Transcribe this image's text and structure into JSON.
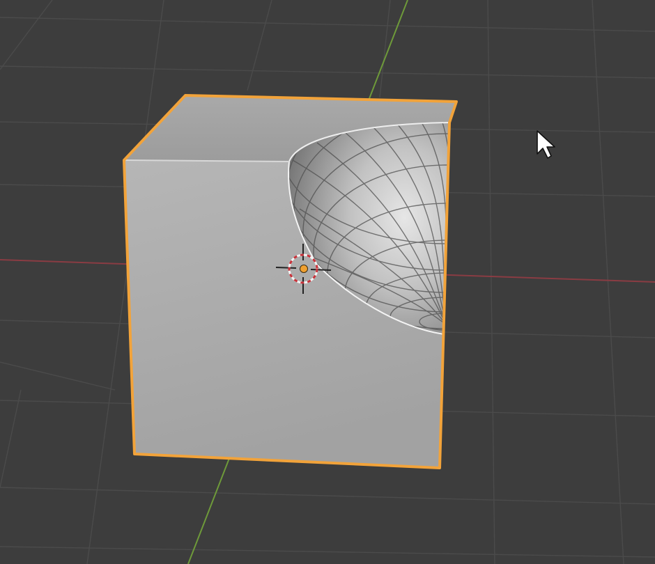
{
  "viewport": {
    "background": "#3d3d3d",
    "grid_color": "#4b4b4b",
    "x_axis_color": "#8a3c43",
    "y_axis_color": "#6e9a3a"
  },
  "object": {
    "type": "cube-with-spherical-cutout",
    "selected": true,
    "selection_outline_color": "#f2a33a",
    "origin_dot_color": "#f0a030"
  },
  "cursor_3d": {
    "ring_colors": [
      "#c8323a",
      "#f2f2f2"
    ]
  },
  "mouse_cursor": {
    "icon": "arrow-pointer-icon"
  }
}
